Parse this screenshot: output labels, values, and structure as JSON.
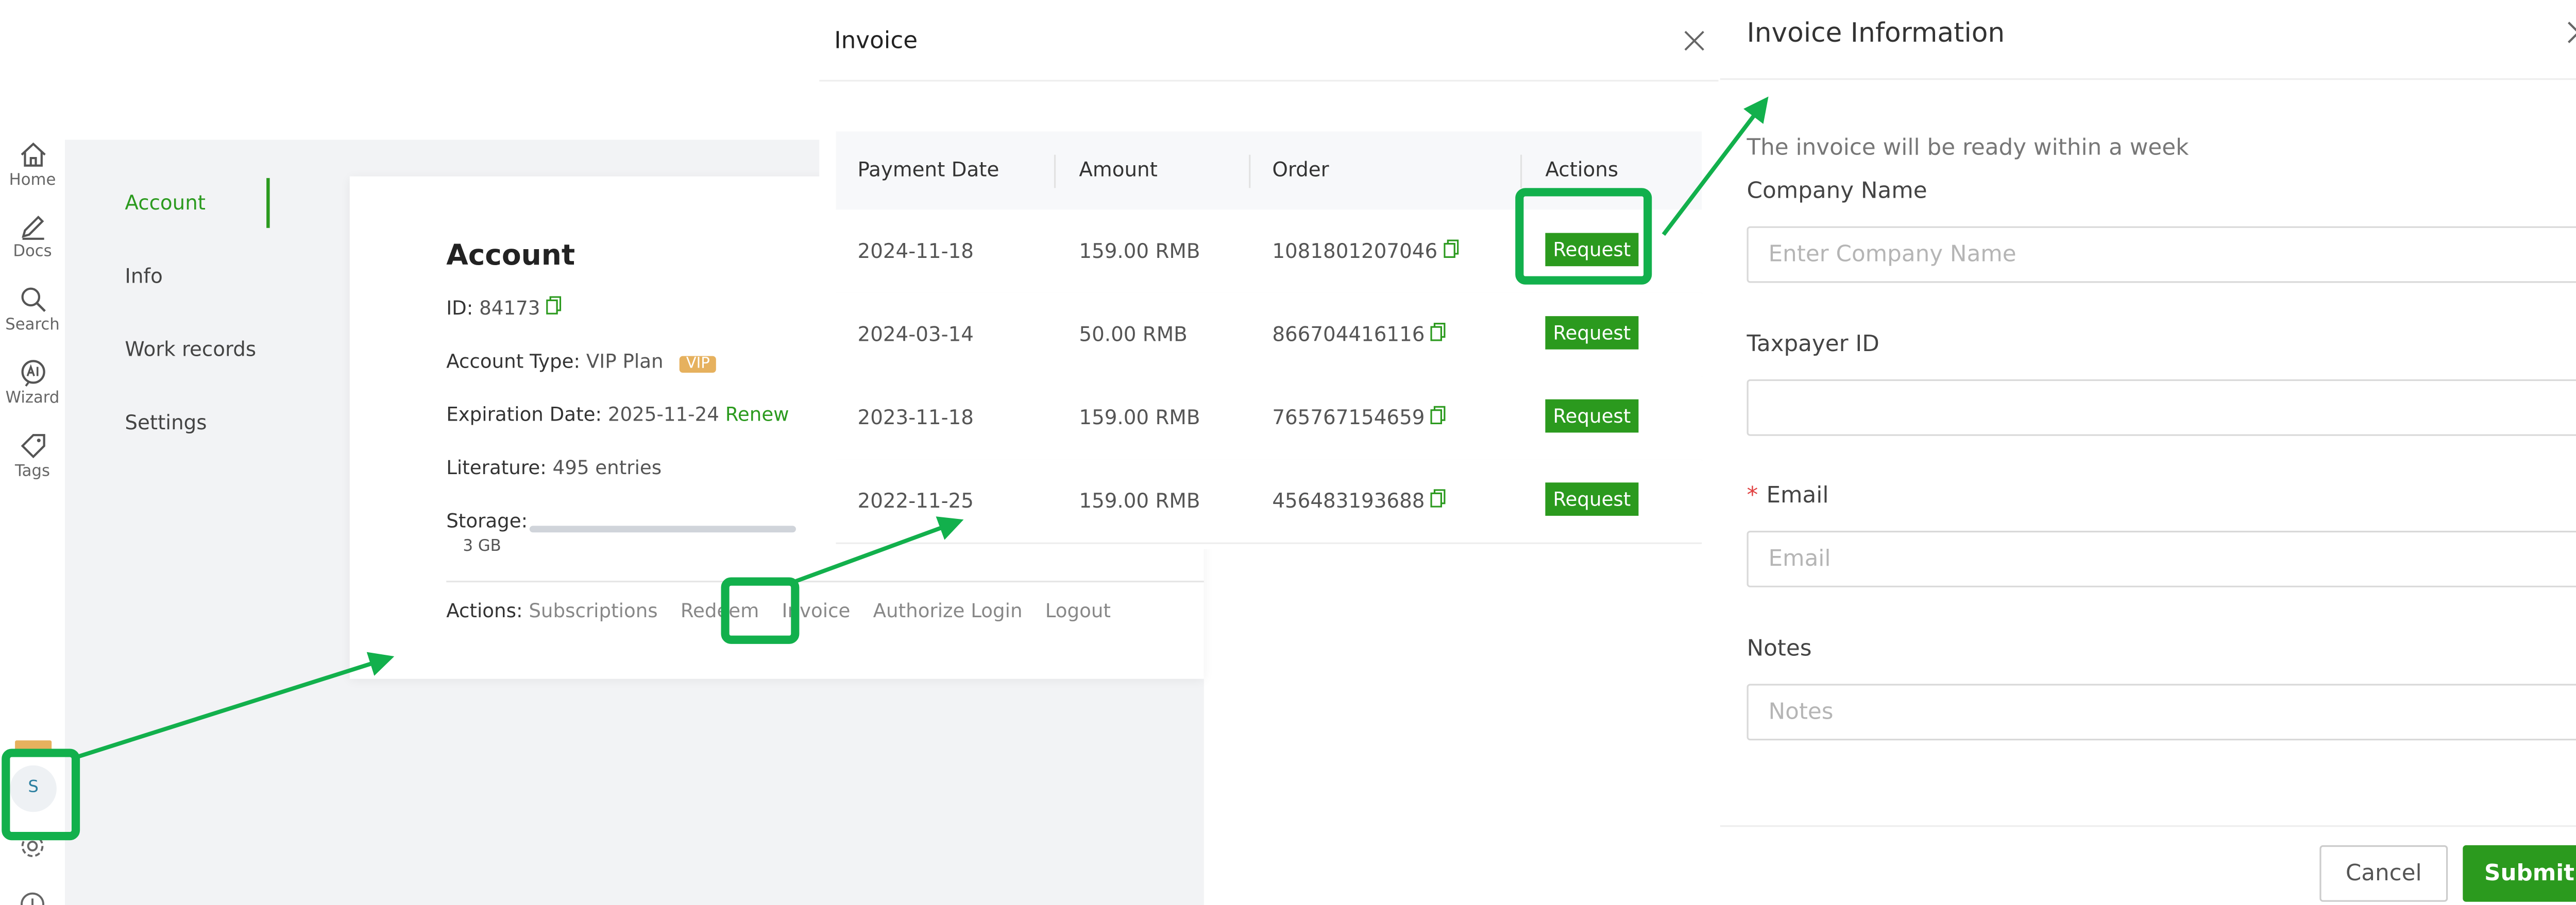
{
  "rail": {
    "items": [
      {
        "label": "Home",
        "icon": "home-icon"
      },
      {
        "label": "Docs",
        "icon": "pen-icon"
      },
      {
        "label": "Search",
        "icon": "search-icon"
      },
      {
        "label": "Wizard",
        "icon": "ai-icon"
      },
      {
        "label": "Tags",
        "icon": "tag-icon"
      }
    ],
    "avatar_letter": "S"
  },
  "account_nav": {
    "items": [
      "Account",
      "Info",
      "Work records",
      "Settings"
    ],
    "active": "Account"
  },
  "account": {
    "title": "Account",
    "id_label": "ID:",
    "id_value": "84173",
    "type_label": "Account Type:",
    "type_value": "VIP Plan",
    "vip_badge": "VIP",
    "expiration_label": "Expiration Date:",
    "expiration_value": "2025-11-24",
    "renew_label": "Renew",
    "literature_label": "Literature:",
    "literature_value": "495 entries",
    "storage_label": "Storage:",
    "storage_value": "3 GB",
    "actions_label": "Actions:",
    "actions": [
      "Subscriptions",
      "Redeem",
      "Invoice",
      "Authorize Login",
      "Logout"
    ]
  },
  "invoice_modal": {
    "title": "Invoice",
    "columns": [
      "Payment Date",
      "Amount",
      "Order",
      "Actions"
    ],
    "rows": [
      {
        "date": "2024-11-18",
        "amount": "159.00 RMB",
        "order": "1081801207046",
        "action": "Request"
      },
      {
        "date": "2024-03-14",
        "amount": "50.00 RMB",
        "order": "866704416116",
        "action": "Request"
      },
      {
        "date": "2023-11-18",
        "amount": "159.00 RMB",
        "order": "765767154659",
        "action": "Request"
      },
      {
        "date": "2022-11-25",
        "amount": "159.00 RMB",
        "order": "456483193688",
        "action": "Request"
      }
    ]
  },
  "invoice_info": {
    "title": "Invoice Information",
    "note": "The invoice will be ready within a week",
    "company_label": "Company Name",
    "company_placeholder": "Enter Company Name",
    "taxpayer_label": "Taxpayer ID",
    "taxpayer_placeholder": "",
    "email_label": "Email",
    "email_placeholder": "Email",
    "notes_label": "Notes",
    "notes_placeholder": "Notes",
    "cancel_label": "Cancel",
    "submit_label": "Submit"
  },
  "colors": {
    "brand_green": "#2b9a1e",
    "highlight_green": "#12b04c",
    "vip_gold": "#e6b15e",
    "required_red": "#e04040"
  }
}
